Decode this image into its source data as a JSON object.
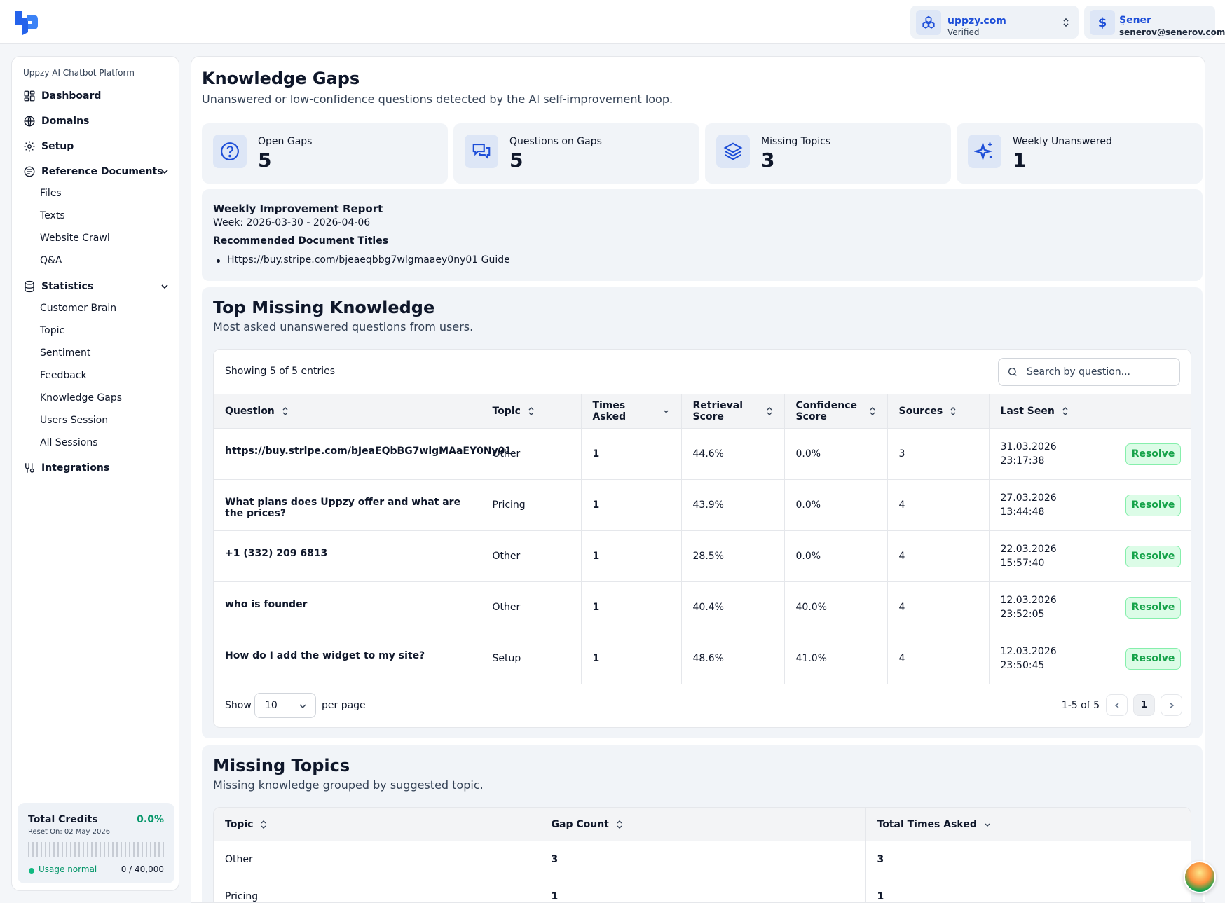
{
  "header": {
    "logo_icon": "uppzy-logo-icon",
    "org": {
      "name": "uppzy.com",
      "status": "Verified"
    },
    "user": {
      "initial": "$",
      "name": "Şener",
      "email": "senerov@senerov.com"
    }
  },
  "sidebar": {
    "platform_title": "Uppzy AI Chatbot Platform",
    "nav": {
      "dashboard": "Dashboard",
      "domains": "Domains",
      "setup": "Setup",
      "reference_documents": "Reference Documents",
      "statistics": "Statistics",
      "integrations": "Integrations"
    },
    "reference_items": [
      "Files",
      "Texts",
      "Website Crawl",
      "Q&A"
    ],
    "statistics_items": [
      "Customer Brain",
      "Topic",
      "Sentiment",
      "Feedback",
      "Knowledge Gaps",
      "Users Session",
      "All Sessions"
    ],
    "credits": {
      "title": "Total Credits",
      "percent": "0.0%",
      "reset": "Reset On: 02 May 2026",
      "status": "Usage normal",
      "usage": "0 / 40,000"
    }
  },
  "page": {
    "title": "Knowledge Gaps",
    "subtitle": "Unanswered or low-confidence questions detected by the AI self-improvement loop."
  },
  "stats": [
    {
      "label": "Open Gaps",
      "value": "5",
      "icon": "question-circle-icon"
    },
    {
      "label": "Questions on Gaps",
      "value": "5",
      "icon": "chat-bubbles-icon"
    },
    {
      "label": "Missing Topics",
      "value": "3",
      "icon": "layers-icon"
    },
    {
      "label": "Weekly Unanswered",
      "value": "1",
      "icon": "sparkles-icon"
    }
  ],
  "report": {
    "title": "Weekly Improvement Report",
    "week": "Week: 2026-03-30 - 2026-04-06",
    "recommended_label": "Recommended Document Titles",
    "recommended": [
      "Https://buy.stripe.com/bjeaeqbbg7wlgmaaey0ny01 Guide"
    ]
  },
  "top_missing": {
    "title": "Top Missing Knowledge",
    "subtitle": "Most asked unanswered questions from users.",
    "showing": "Showing 5 of 5 entries",
    "search_placeholder": "Search by question...",
    "columns": [
      "Question",
      "Topic",
      "Times Asked",
      "Retrieval Score",
      "Confidence Score",
      "Sources",
      "Last Seen"
    ],
    "resolve_label": "Resolve",
    "rows": [
      {
        "question": "https://buy.stripe.com/bJeaEQbBG7wlgMAaEY0Ny01",
        "topic": "Other",
        "times": "1",
        "retrieval": "44.6%",
        "confidence": "0.0%",
        "sources": "3",
        "date": "31.03.2026",
        "time": "23:17:38"
      },
      {
        "question": "What plans does Uppzy offer and what are the prices?",
        "topic": "Pricing",
        "times": "1",
        "retrieval": "43.9%",
        "confidence": "0.0%",
        "sources": "4",
        "date": "27.03.2026",
        "time": "13:44:48"
      },
      {
        "question": "+1 (332) 209 6813",
        "topic": "Other",
        "times": "1",
        "retrieval": "28.5%",
        "confidence": "0.0%",
        "sources": "4",
        "date": "22.03.2026",
        "time": "15:57:40"
      },
      {
        "question": "who is founder",
        "topic": "Other",
        "times": "1",
        "retrieval": "40.4%",
        "confidence": "40.0%",
        "sources": "4",
        "date": "12.03.2026",
        "time": "23:52:05"
      },
      {
        "question": "How do I add the widget to my site?",
        "topic": "Setup",
        "times": "1",
        "retrieval": "48.6%",
        "confidence": "41.0%",
        "sources": "4",
        "date": "12.03.2026",
        "time": "23:50:45"
      }
    ],
    "pagination": {
      "show": "Show",
      "per_page_value": "10",
      "per_page": "per page",
      "range": "1-5 of 5",
      "current_page": "1"
    }
  },
  "missing_topics": {
    "title": "Missing Topics",
    "subtitle": "Missing knowledge grouped by suggested topic.",
    "columns": [
      "Topic",
      "Gap Count",
      "Total Times Asked"
    ],
    "rows": [
      {
        "topic": "Other",
        "gap_count": "3",
        "total": "3"
      },
      {
        "topic": "Pricing",
        "gap_count": "1",
        "total": "1"
      }
    ]
  },
  "colors": {
    "accent": "#1d4ed8",
    "success": "#16a34a",
    "surface": "#f1f4f8"
  }
}
